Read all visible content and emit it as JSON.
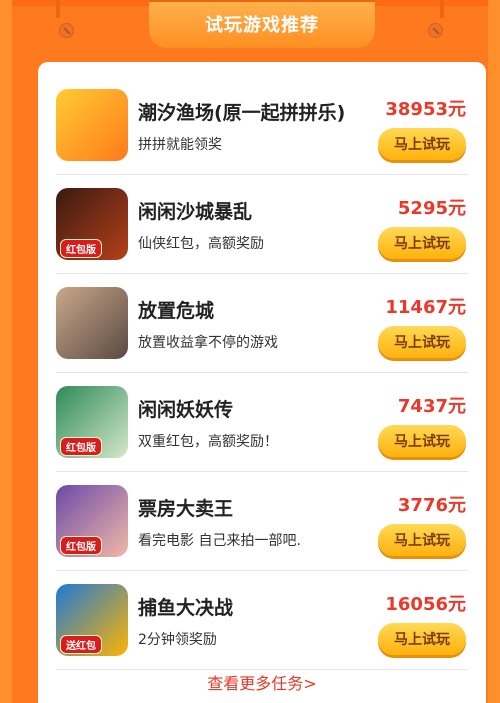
{
  "header": {
    "title": "试玩游戏推荐"
  },
  "games": [
    {
      "title": "潮汐渔场(原一起拼拼乐)",
      "subtitle": "拼拼就能领奖",
      "amount": "38953元",
      "button": "马上试玩",
      "icon": "fish-dragon-icon",
      "colors": [
        "#ffcc33",
        "#ff7a1a"
      ]
    },
    {
      "title": "闲闲沙城暴乱",
      "subtitle": "仙侠红包，高额奖励",
      "amount": "5295元",
      "button": "马上试玩",
      "icon": "sand-city-icon",
      "badge": "红包版",
      "colors": [
        "#3a1a10",
        "#b5401a"
      ]
    },
    {
      "title": "放置危城",
      "subtitle": "放置收益拿不停的游戏",
      "amount": "11467元",
      "button": "马上试玩",
      "icon": "ruined-city-icon",
      "colors": [
        "#c9a88a",
        "#5a4a42"
      ]
    },
    {
      "title": "闲闲妖妖传",
      "subtitle": "双重红包，高额奖励！",
      "amount": "7437元",
      "button": "马上试玩",
      "icon": "fairy-girl-icon",
      "badge": "红包版",
      "colors": [
        "#2e8a5a",
        "#d4e8c8"
      ]
    },
    {
      "title": "票房大卖王",
      "subtitle": "看完电影 自己来拍一部吧.",
      "amount": "3776元",
      "button": "马上试玩",
      "icon": "movie-girl-icon",
      "badge": "红包版",
      "colors": [
        "#6b4aa8",
        "#f2b8a8"
      ]
    },
    {
      "title": "捕鱼大决战",
      "subtitle": "2分钟领奖励",
      "amount": "16056元",
      "button": "马上试玩",
      "icon": "shark-icon",
      "badge": "送红包",
      "colors": [
        "#1e7ad6",
        "#ffb400"
      ]
    }
  ],
  "footer": {
    "more_label": "查看更多任务>"
  }
}
